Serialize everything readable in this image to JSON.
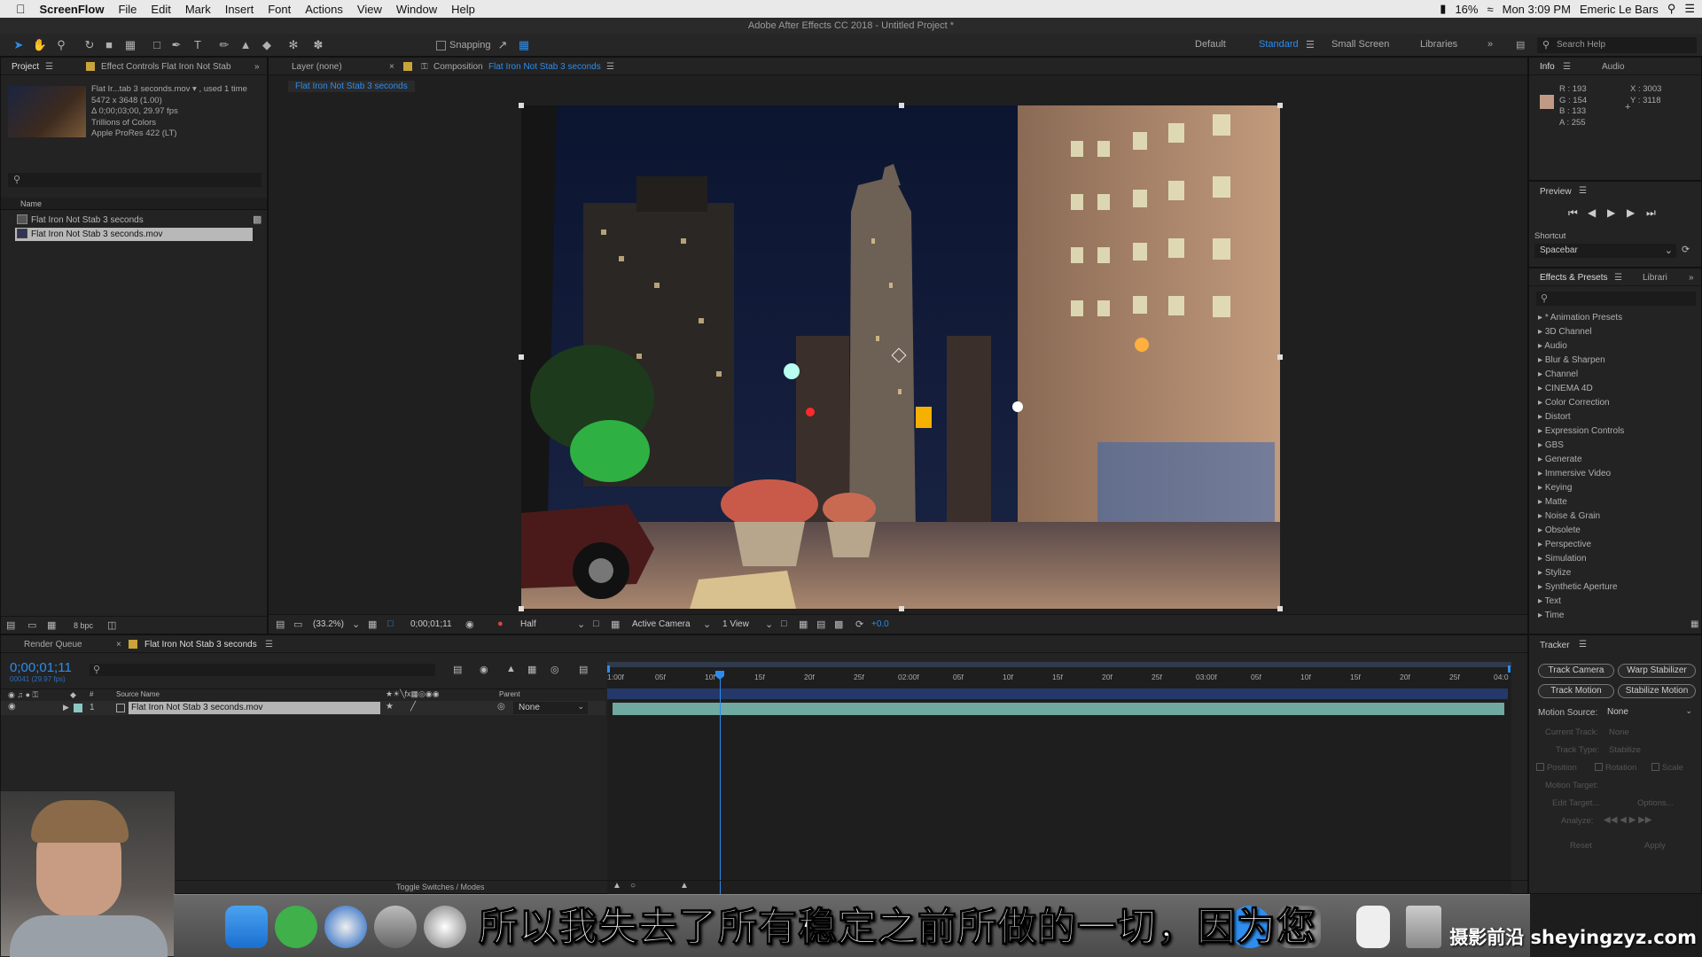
{
  "menubar": {
    "app_name": "ScreenFlow",
    "items": [
      "File",
      "Edit",
      "Mark",
      "Insert",
      "Font",
      "Actions",
      "View",
      "Window",
      "Help"
    ],
    "battery": "16%",
    "clock": "Mon 3:09 PM",
    "user": "Emeric Le Bars"
  },
  "title": "Adobe After Effects CC 2018 - Untitled Project *",
  "toolbar": {
    "snapping_label": "Snapping",
    "workspaces": [
      "Default",
      "Standard",
      "Small Screen",
      "Libraries"
    ],
    "active_workspace": "Standard",
    "search_placeholder": "Search Help"
  },
  "project_panel": {
    "tab_label": "Project",
    "effect_controls_label": "Effect Controls Flat Iron Not Stab",
    "footage_name": "Flat Ir...tab 3 seconds.mov ▾ , used 1 time",
    "footage_size": "5472 x 3648 (1.00)",
    "footage_duration": "Δ 0;00;03;00, 29.97 fps",
    "footage_colors": "Trillions of Colors",
    "footage_codec": "Apple ProRes 422 (LT)",
    "column_name": "Name",
    "items": [
      "Flat Iron Not Stab 3 seconds",
      "Flat Iron Not Stab 3 seconds.mov"
    ],
    "bpc": "8 bpc"
  },
  "comp_panel": {
    "layer_tab": "Layer (none)",
    "comp_tab_prefix": "Composition",
    "comp_tab_name": "Flat Iron Not Stab 3 seconds",
    "comp_subtab": "Flat Iron Not Stab 3 seconds",
    "zoom": "(33.2%)",
    "timecode": "0;00;01;11",
    "resolution": "Half",
    "camera": "Active Camera",
    "views": "1 View",
    "exposure": "+0.0"
  },
  "info_panel": {
    "tabs": [
      "Info",
      "Audio"
    ],
    "r": "R : 193",
    "g": "G : 154",
    "b": "B : 133",
    "a": "A : 255",
    "x": "X : 3003",
    "y": "Y : 3118",
    "swatch_color": "#c19a85"
  },
  "preview_panel": {
    "label": "Preview",
    "shortcut_label": "Shortcut",
    "shortcut_value": "Spacebar"
  },
  "effects_panel": {
    "tabs": [
      "Effects & Presets",
      "Librari"
    ],
    "items": [
      "* Animation Presets",
      "3D Channel",
      "Audio",
      "Blur & Sharpen",
      "Channel",
      "CINEMA 4D",
      "Color Correction",
      "Distort",
      "Expression Controls",
      "GBS",
      "Generate",
      "Immersive Video",
      "Keying",
      "Matte",
      "Noise & Grain",
      "Obsolete",
      "Perspective",
      "Simulation",
      "Stylize",
      "Synthetic Aperture",
      "Text",
      "Time"
    ]
  },
  "tracker_panel": {
    "label": "Tracker",
    "track_camera": "Track Camera",
    "warp_stabilizer": "Warp Stabilizer",
    "track_motion": "Track Motion",
    "stabilize_motion": "Stabilize Motion",
    "motion_source_label": "Motion Source:",
    "motion_source_value": "None",
    "current_track": "Current Track:",
    "current_track_value": "None",
    "track_type": "Track Type:",
    "track_type_value": "Stabilize",
    "position": "Position",
    "rotation": "Rotation",
    "scale": "Scale",
    "motion_target": "Motion Target:",
    "edit_target": "Edit Target...",
    "options": "Options...",
    "analyze": "Analyze:",
    "reset": "Reset",
    "apply": "Apply"
  },
  "timeline": {
    "render_queue": "Render Queue",
    "comp_tab": "Flat Iron Not Stab 3 seconds",
    "timecode": "0;00;01;11",
    "frame_info": "00041 (29.97 fps)",
    "col_source": "Source Name",
    "col_parent": "Parent",
    "layer_num": "1",
    "layer_name": "Flat Iron Not Stab 3 seconds.mov",
    "parent_value": "None",
    "ruler": [
      "1:00f",
      "05f",
      "10f",
      "15f",
      "20f",
      "25f",
      "02:00f",
      "05f",
      "10f",
      "15f",
      "20f",
      "25f",
      "03:00f",
      "05f",
      "10f",
      "15f",
      "20f",
      "25f",
      "04:0"
    ],
    "toggle_label": "Toggle Switches / Modes"
  },
  "overlay": {
    "subtitle": "所以我失去了所有稳定之前所做的一切，因为您",
    "watermark": "摄影前沿 sheyingzyz.com"
  }
}
